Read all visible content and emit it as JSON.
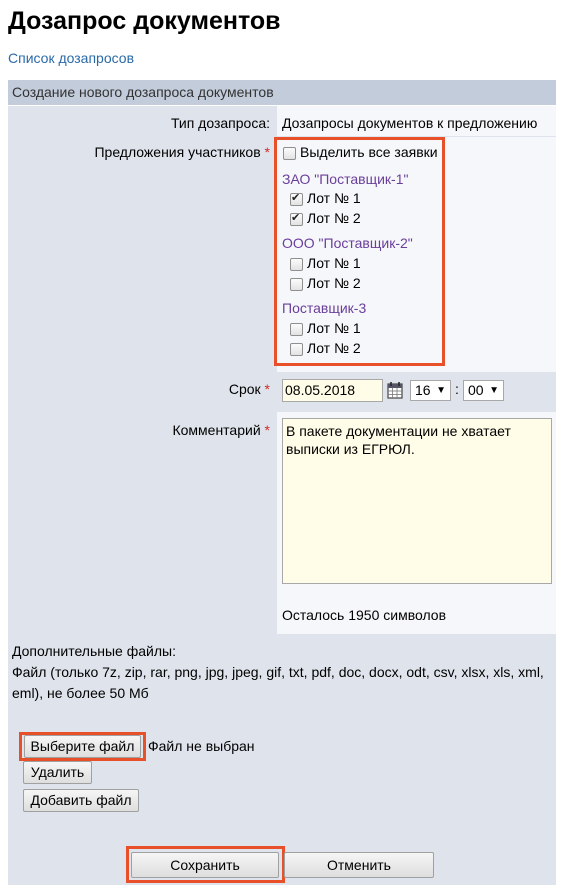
{
  "page": {
    "title": "Дозапрос документов",
    "back_link": "Список дозапросов"
  },
  "form": {
    "header": "Создание нового дозапроса документов",
    "type_label": "Тип дозапроса:",
    "type_value": "Дозапросы документов к предложению",
    "offers_label": "Предложения участников",
    "required_mark": "*",
    "select_all_label": "Выделить все заявки",
    "select_all_checked": false,
    "suppliers": [
      {
        "name": "ЗАО \"Поставщик-1\"",
        "lots": [
          {
            "label": "Лот № 1",
            "checked": true
          },
          {
            "label": "Лот № 2",
            "checked": true
          }
        ]
      },
      {
        "name": "ООО \"Поставщик-2\"",
        "lots": [
          {
            "label": "Лот № 1",
            "checked": false
          },
          {
            "label": "Лот № 2",
            "checked": false
          }
        ]
      },
      {
        "name": "Поставщик-3",
        "lots": [
          {
            "label": "Лот № 1",
            "checked": false
          },
          {
            "label": "Лот № 2",
            "checked": false
          }
        ]
      }
    ],
    "deadline_label": "Срок",
    "deadline_date": "08.05.2018",
    "calendar_icon": "calendar-icon",
    "deadline_hour": "16",
    "time_separator": ":",
    "deadline_minute": "00",
    "comment_label": "Комментарий",
    "comment_value": "В пакете документации не хватает выписки из ЕГРЮЛ.",
    "chars_left": "Осталось 1950 символов",
    "files_title": "Дополнительные файлы:",
    "files_hint": "Файл (только 7z, zip, rar, png, jpg, jpeg, gif, txt, pdf, doc, docx, odt, csv, xlsx, xls, xml, eml), не более 50 Мб",
    "choose_file_button": "Выберите файл",
    "no_file_text": "Файл не выбран",
    "delete_button": "Удалить",
    "add_file_button": "Добавить файл",
    "save_button": "Сохранить",
    "cancel_button": "Отменить"
  },
  "colors": {
    "highlight": "#e8502a",
    "link": "#2a6aa8",
    "supplier": "#6a3e9b",
    "panel": "#dfe4ec",
    "header": "#c3ccda",
    "input_bg": "#fffde7"
  }
}
